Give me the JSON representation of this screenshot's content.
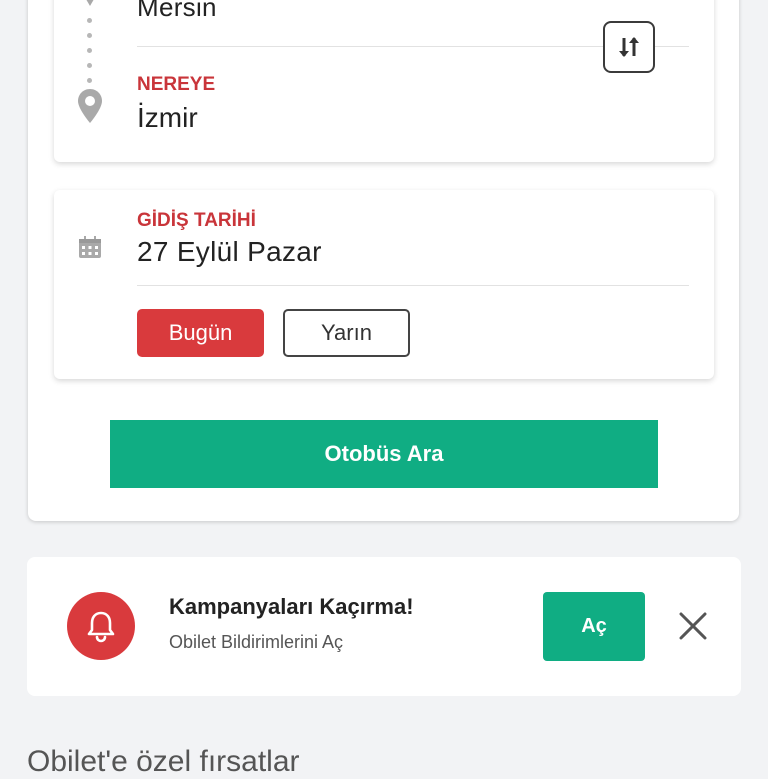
{
  "route": {
    "from_value": "Mersin",
    "to_label": "NEREYE",
    "to_value": "İzmir",
    "swap_icon": "swap-vertical-icon",
    "pin_icon": "location-pin-icon"
  },
  "date": {
    "label": "GİDİŞ TARİHİ",
    "value": "27 Eylül Pazar",
    "icon": "calendar-icon",
    "today_label": "Bugün",
    "tomorrow_label": "Yarın"
  },
  "search": {
    "button_label": "Otobüs Ara"
  },
  "notification": {
    "title": "Kampanyaları Kaçırma!",
    "subtitle": "Obilet Bildirimlerini Aç",
    "open_label": "Aç",
    "icon": "bell-icon",
    "close_icon": "close-icon"
  },
  "section": {
    "title": "Obilet'e özel fırsatlar"
  },
  "colors": {
    "accent_red": "#d93a3d",
    "label_red": "#c9353a",
    "accent_green": "#10ad83",
    "background": "#f2f3f5"
  }
}
